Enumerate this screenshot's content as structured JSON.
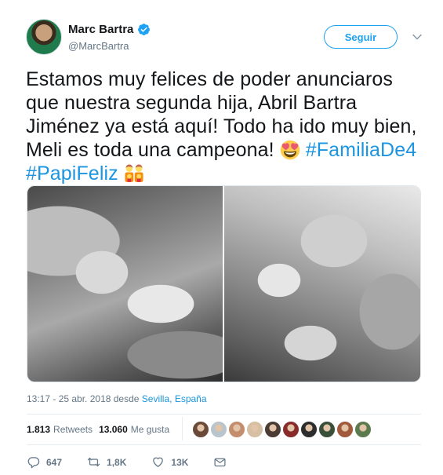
{
  "author": {
    "name": "Marc Bartra",
    "handle": "@MarcBartra"
  },
  "follow_button": "Seguir",
  "tweet": {
    "line1": "Estamos muy felices de poder anunciaros",
    "line2": "que nuestra segunda hija, Abril Bartra",
    "line3": "Jiménez ya está aquí! Todo ha ido muy bien,",
    "line4_text": "Meli es toda una campeona! ",
    "hashtag1": "#FamiliaDe4",
    "hashtag2": "#PapiFeliz"
  },
  "meta": {
    "time": "13:17 - 25 abr. 2018",
    "from": " desde ",
    "location": "Sevilla, España"
  },
  "stats": {
    "retweets_count": "1.813",
    "retweets_label": "Retweets",
    "likes_count": "13.060",
    "likes_label": "Me gusta"
  },
  "actions": {
    "replies": "647",
    "retweets": "1,8K",
    "likes": "13K"
  },
  "icons": {
    "verified": "verified-badge-icon",
    "caret": "chevron-down-icon",
    "emoji1": "heart-eyes-emoji",
    "emoji2": "family-emoji",
    "reply": "reply-icon",
    "retweet": "retweet-icon",
    "like": "heart-icon",
    "dm": "envelope-icon"
  },
  "colors": {
    "accent": "#1da1f2",
    "link": "#1b95e0",
    "text": "#14171a",
    "muted": "#657786"
  },
  "liker_colors": [
    "#6b4a3a",
    "#b9c4cc",
    "#c48e6e",
    "#d6bfa3",
    "#4a3b35",
    "#8a2b2b",
    "#2d2d2d",
    "#3a4f3a",
    "#a25a3c",
    "#5b7b4e"
  ]
}
